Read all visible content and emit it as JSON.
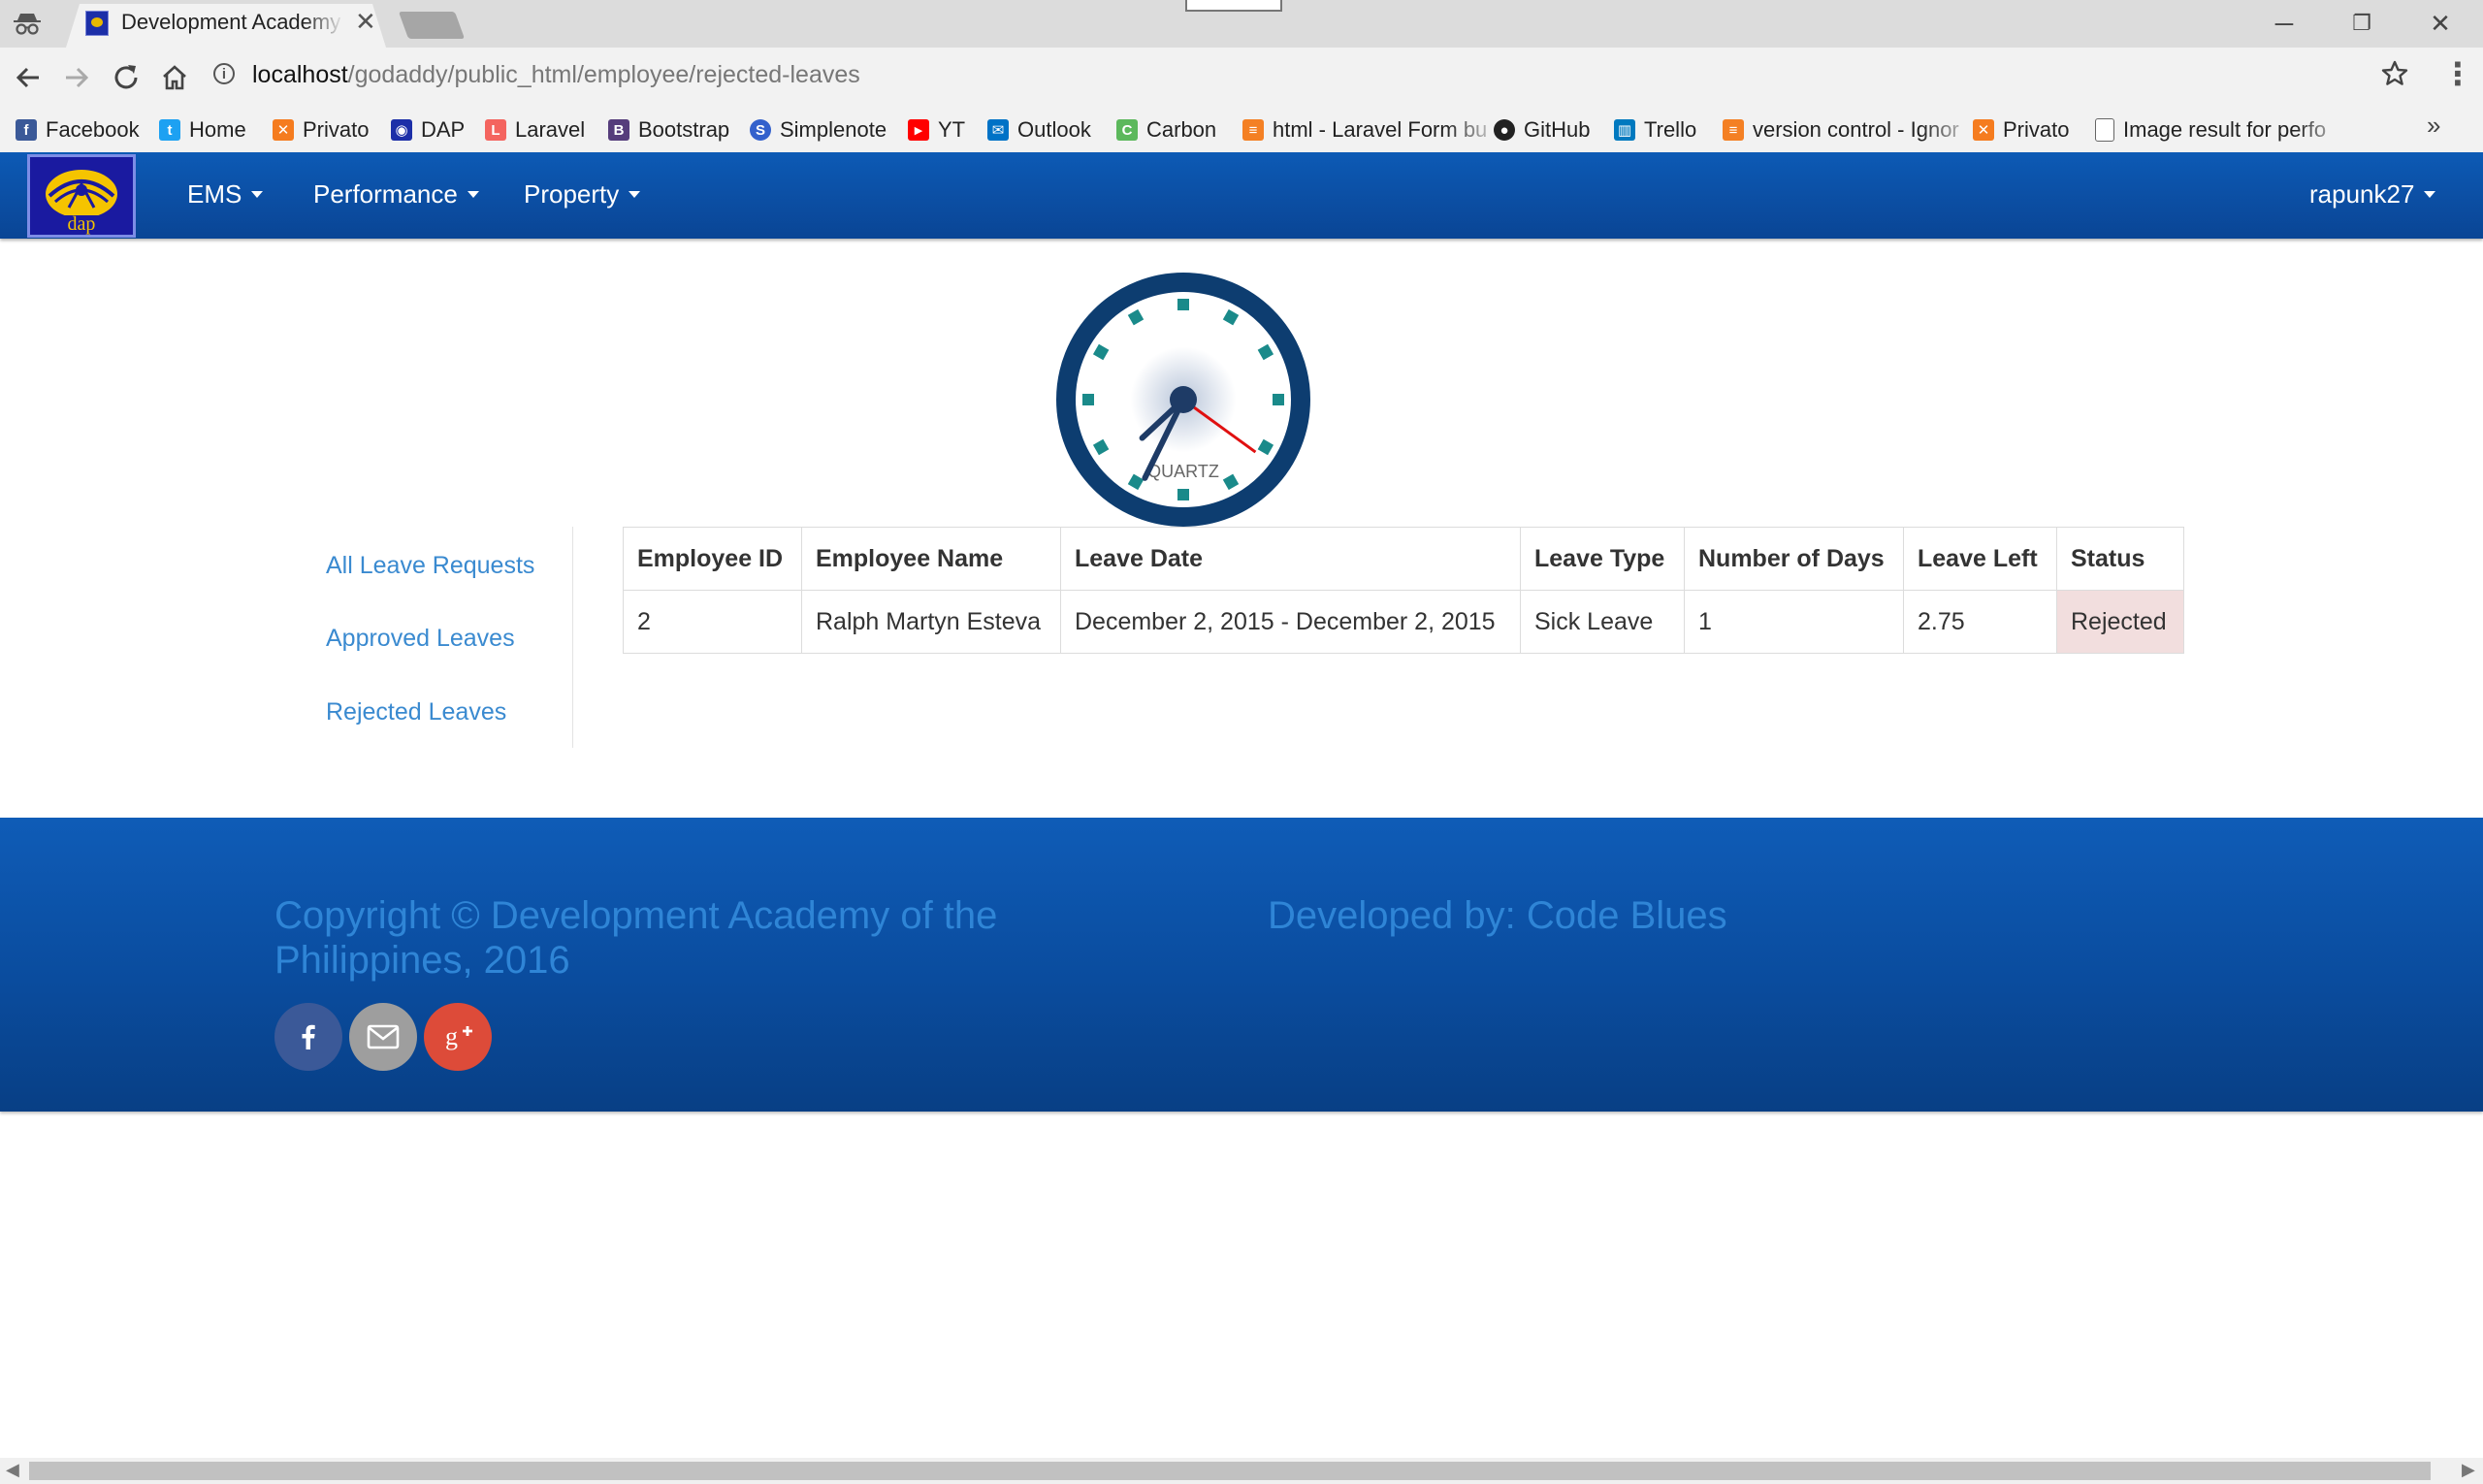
{
  "browser": {
    "tab_title": "Development Academy of the Philippines",
    "tab_close": "✕",
    "url_host": "localhost",
    "url_path": "/godaddy/public_html/employee/rejected-leaves",
    "window_controls": {
      "minimize": "─",
      "restore": "❐",
      "close": "✕"
    },
    "bookmarks": [
      {
        "label": "Facebook",
        "icon": "facebook-icon",
        "color": "#3b5998"
      },
      {
        "label": "Home",
        "icon": "twitter-icon",
        "color": "#1da1f2"
      },
      {
        "label": "Privato",
        "icon": "xampp-icon",
        "color": "#f57c1f"
      },
      {
        "label": "DAP",
        "icon": "dap-icon",
        "color": "#1c2fa8"
      },
      {
        "label": "Laravel",
        "icon": "laravel-icon",
        "color": "#f4645f"
      },
      {
        "label": "Bootstrap",
        "icon": "bootstrap-icon",
        "color": "#563d7c"
      },
      {
        "label": "Simplenote",
        "icon": "simplenote-icon",
        "color": "#3361cc"
      },
      {
        "label": "YT",
        "icon": "youtube-icon",
        "color": "#ff0000"
      },
      {
        "label": "Outlook",
        "icon": "outlook-icon",
        "color": "#0072c6"
      },
      {
        "label": "Carbon",
        "icon": "carbon-icon",
        "color": "#5cb85c"
      },
      {
        "label": "html - Laravel Form bu",
        "icon": "stackoverflow-icon",
        "color": "#f48024"
      },
      {
        "label": "GitHub",
        "icon": "github-icon",
        "color": "#222222"
      },
      {
        "label": "Trello",
        "icon": "trello-icon",
        "color": "#0079bf"
      },
      {
        "label": "version control - Ignor",
        "icon": "stackoverflow-icon",
        "color": "#f48024"
      },
      {
        "label": "Privato",
        "icon": "xampp-icon",
        "color": "#f57c1f"
      },
      {
        "label": "Image result for perfo",
        "icon": "page-icon",
        "color": "#ffffff"
      }
    ],
    "bookmarks_more": "»"
  },
  "navbar": {
    "logo_text": "dap",
    "menus": [
      "EMS",
      "Performance",
      "Property"
    ],
    "user": "rapunk27"
  },
  "clock": {
    "label": "QUARTZ",
    "time": {
      "hour": 7,
      "minute": 34,
      "second": 21
    }
  },
  "sidebar": {
    "links": [
      "All Leave Requests",
      "Approved Leaves",
      "Rejected Leaves"
    ]
  },
  "table": {
    "headers": [
      "Employee ID",
      "Employee Name",
      "Leave Date",
      "Leave Type",
      "Number of Days",
      "Leave Left",
      "Status"
    ],
    "rows": [
      [
        "2",
        "Ralph Martyn Esteva",
        "December 2, 2015 - December 2, 2015",
        "Sick Leave",
        "1",
        "2.75",
        "Rejected"
      ]
    ]
  },
  "footer": {
    "copyright": "Copyright © Development Academy of the Philippines, 2016",
    "developed_by": "Developed by: Code Blues",
    "social": [
      {
        "name": "facebook",
        "color": "#3b5998"
      },
      {
        "name": "email",
        "color": "#9e9e9e"
      },
      {
        "name": "google-plus",
        "color": "#dd4b39"
      }
    ]
  }
}
